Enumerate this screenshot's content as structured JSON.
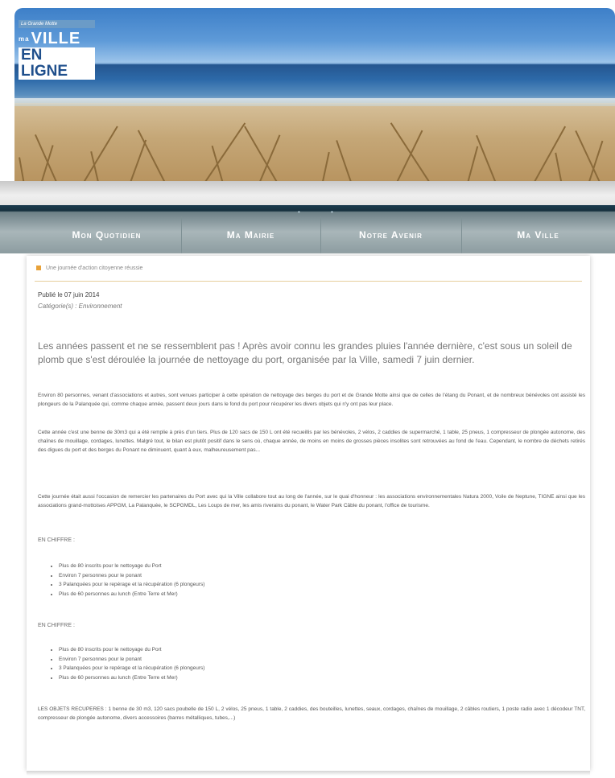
{
  "logo": {
    "tagline": "La Grande Motte",
    "line1_small": "ma",
    "line1": "VILLE",
    "line2": "EN LIGNE"
  },
  "nav": [
    "Mon Quotidien",
    "Ma Mairie",
    "Notre Avenir",
    "Ma Ville"
  ],
  "breadcrumb": "Une journée d'action citoyenne réussie",
  "article": {
    "pubdate": "Publié le 07 juin 2014",
    "category": "Catégorie(s) : Environnement",
    "lead": "Les années passent et ne se ressemblent pas ! Après avoir connu les grandes pluies l'année dernière, c'est sous un soleil de plomb que s'est déroulée la journée de nettoyage du port, organisée par la Ville, samedi 7 juin dernier.",
    "p1": "Environ 80 personnes, venant d'associations et autres, sont venues participer à cette opération de nettoyage des berges du port et de Grande Motte ainsi que de celles de l'étang du Ponant, et de nombreux bénévoles ont assisté les plongeurs de la Palanquée qui, comme chaque année, passent deux jours dans le fond du port pour récupérer les divers objets qui n'y ont pas leur place.",
    "p2": "Cette année c'est une benne de 30m3 qui a été remplie à près d'un tiers. Plus de 120 sacs de 150 L ont été recueillis par les bénévoles, 2 vélos, 2 caddies de supermarché, 1 table, 25 pneus, 1 compresseur de plongée autonome, des chaînes de mouillage, cordages, lunettes. Malgré tout, le bilan est plutôt positif dans le sens où, chaque année, de moins en moins de grosses pièces insolites sont retrouvées au fond de l'eau. Cependant, le nombre de déchets retirés des digues du port et des berges du Ponant ne diminuent, quant à eux, malheureusement pas...",
    "p3": "Cette journée était aussi l'occasion de remercier les partenaires du Port avec qui la Ville collabore tout au long de l'année, sur le quai d'honneur : les associations environnementales Natura 2000, Voile de Neptune, TIGNE ainsi que les associations grand-mottoises APPGM, La Palanquée, le SCPGMDL, Les Loups de mer, les amis riverains du ponant, le Water Park Câble du ponant, l'office de tourisme.",
    "section1_title": "EN CHIFFRE :",
    "section1_items": [
      "Plus de 80 inscrits pour le nettoyage du Port",
      "Environ 7 personnes pour le ponant",
      "3 Palanquées pour le repérage et la récupération (6 plongeurs)",
      "Plus de 60 personnes au lunch (Entre Terre et Mer)"
    ],
    "section2_title": "EN CHIFFRE :",
    "section2_items": [
      "Plus de 80 inscrits pour le nettoyage du Port",
      "Environ 7 personnes pour le ponant",
      "3 Palanquées pour le repérage et la récupération (6 plongeurs)",
      "Plus de 60 personnes au lunch (Entre Terre et Mer)"
    ],
    "objects": "LES OBJETS RECUPERES : 1 benne de 30 m3, 120 sacs poubelle de 150 L, 2 vélos, 25 pneus, 1 table, 2 caddies, des bouteilles, lunettes, seaux, cordages, chaînes de mouillage, 2 câbles routiers, 1 poste radio avec 1 décodeur TNT, compresseur de plongée autonome, divers accessoires (barres métalliques, tubes,...)"
  },
  "colors": {
    "nav_top": "#17303e",
    "nav_bg": "#a9b6b9",
    "breadcrumb_bullet": "#e8a23a",
    "rule": "#e6cf9c"
  }
}
